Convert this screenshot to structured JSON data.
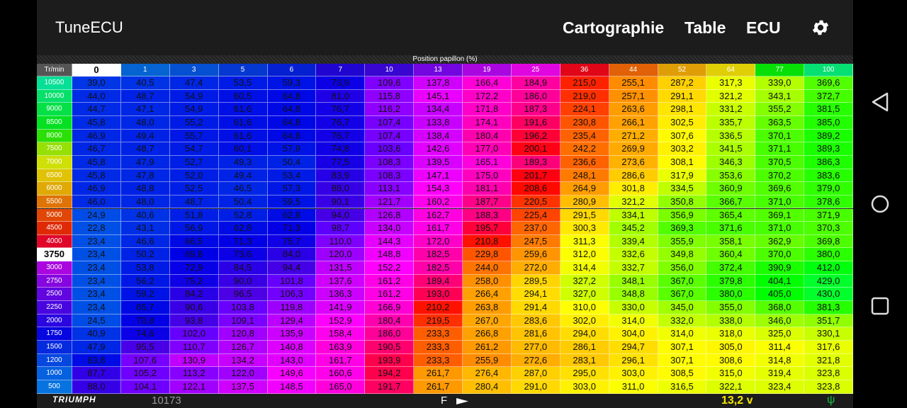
{
  "app": {
    "title": "TuneECU",
    "menu": [
      "Cartographie",
      "Table",
      "ECU"
    ]
  },
  "icons": {
    "settings": "gear-icon",
    "back": "triangle-back-icon",
    "home": "circle-home-icon",
    "recents": "square-recents-icon",
    "usb": "usb-icon",
    "arrow": "play-arrow-icon"
  },
  "table": {
    "caption": "Position papillon (%)",
    "corner": "Tr/min",
    "columns": [
      "0",
      "1",
      "3",
      "5",
      "6",
      "7",
      "10",
      "13",
      "19",
      "25",
      "36",
      "44",
      "52",
      "64",
      "77",
      "100"
    ],
    "selected_col": 0,
    "selected_row": 13,
    "rows": [
      {
        "rpm": "10500",
        "values": [
          "39,0",
          "40,5",
          "47,4",
          "53,5",
          "59,3",
          "73,9",
          "109,6",
          "137,8",
          "166,4",
          "184,9",
          "215,0",
          "255,1",
          "287,2",
          "317,3",
          "339,0",
          "369,6"
        ]
      },
      {
        "rpm": "10000",
        "values": [
          "44,0",
          "48,7",
          "54,9",
          "60,5",
          "64,8",
          "81,0",
          "115,8",
          "145,1",
          "172,2",
          "186,0",
          "219,0",
          "257,1",
          "291,1",
          "321,2",
          "343,1",
          "372,7"
        ]
      },
      {
        "rpm": "9000",
        "values": [
          "44,7",
          "47,1",
          "54,9",
          "61,6",
          "64,8",
          "76,7",
          "116,2",
          "134,4",
          "171,8",
          "187,3",
          "224,1",
          "263,6",
          "298,1",
          "331,2",
          "355,2",
          "381,5"
        ]
      },
      {
        "rpm": "8500",
        "values": [
          "45,8",
          "48,0",
          "55,2",
          "61,6",
          "64,8",
          "76,7",
          "107,4",
          "133,8",
          "174,1",
          "191,6",
          "230,8",
          "266,1",
          "302,5",
          "335,7",
          "363,5",
          "385,0"
        ]
      },
      {
        "rpm": "8000",
        "values": [
          "46,9",
          "49,4",
          "55,7",
          "61,6",
          "64,8",
          "76,7",
          "107,4",
          "138,4",
          "180,4",
          "196,2",
          "235,4",
          "271,2",
          "307,6",
          "336,5",
          "370,1",
          "389,2"
        ]
      },
      {
        "rpm": "7500",
        "values": [
          "46,7",
          "48,7",
          "54,7",
          "60,1",
          "57,9",
          "74,8",
          "103,6",
          "142,6",
          "177,0",
          "200,1",
          "242,2",
          "269,9",
          "303,2",
          "341,5",
          "371,1",
          "389,3"
        ]
      },
      {
        "rpm": "7000",
        "values": [
          "45,8",
          "47,9",
          "52,7",
          "49,3",
          "50,4",
          "77,5",
          "108,3",
          "139,5",
          "165,1",
          "189,3",
          "236,6",
          "273,6",
          "308,1",
          "346,3",
          "370,5",
          "386,3"
        ]
      },
      {
        "rpm": "6500",
        "values": [
          "45,8",
          "47,8",
          "52,0",
          "49,4",
          "53,4",
          "83,9",
          "108,3",
          "147,1",
          "175,0",
          "201,7",
          "248,1",
          "286,6",
          "317,9",
          "353,6",
          "370,2",
          "383,6"
        ]
      },
      {
        "rpm": "6000",
        "values": [
          "46,9",
          "48,8",
          "52,5",
          "46,5",
          "57,3",
          "88,0",
          "113,1",
          "154,3",
          "181,1",
          "208,6",
          "264,9",
          "301,8",
          "334,5",
          "360,9",
          "369,6",
          "379,0"
        ]
      },
      {
        "rpm": "5500",
        "values": [
          "46,0",
          "48,0",
          "48,7",
          "50,4",
          "59,5",
          "90,1",
          "121,7",
          "160,2",
          "187,7",
          "220,5",
          "280,9",
          "321,2",
          "350,8",
          "366,7",
          "371,0",
          "378,6"
        ]
      },
      {
        "rpm": "5000",
        "values": [
          "24,9",
          "40,6",
          "51,8",
          "52,8",
          "62,8",
          "94,0",
          "126,8",
          "162,7",
          "188,3",
          "225,4",
          "291,5",
          "334,1",
          "356,9",
          "365,4",
          "369,1",
          "371,9"
        ]
      },
      {
        "rpm": "4500",
        "values": [
          "22,8",
          "43,1",
          "56,9",
          "62,8",
          "71,3",
          "98,7",
          "134,0",
          "161,7",
          "195,7",
          "237,0",
          "300,3",
          "345,2",
          "369,3",
          "371,6",
          "371,0",
          "370,3"
        ]
      },
      {
        "rpm": "4000",
        "values": [
          "23,4",
          "46,6",
          "66,5",
          "71,3",
          "75,7",
          "110,0",
          "144,3",
          "172,0",
          "210,8",
          "247,5",
          "311,3",
          "339,4",
          "355,9",
          "358,1",
          "362,9",
          "369,8"
        ]
      },
      {
        "rpm": "3750",
        "values": [
          "23,4",
          "50,2",
          "69,8",
          "73,6",
          "84,0",
          "120,0",
          "148,8",
          "182,5",
          "229,8",
          "259,6",
          "312,0",
          "332,6",
          "349,8",
          "360,4",
          "370,0",
          "380,0"
        ]
      },
      {
        "rpm": "3000",
        "values": [
          "23,4",
          "53,8",
          "72,9",
          "84,5",
          "94,4",
          "131,5",
          "152,2",
          "182,5",
          "244,0",
          "272,0",
          "314,4",
          "332,7",
          "356,0",
          "372,4",
          "390,9",
          "412,0"
        ]
      },
      {
        "rpm": "2750",
        "values": [
          "23,4",
          "56,2",
          "75,2",
          "90,0",
          "101,8",
          "137,6",
          "161,2",
          "189,4",
          "258,0",
          "289,5",
          "327,2",
          "348,1",
          "367,0",
          "379,8",
          "404,1",
          "429,0"
        ]
      },
      {
        "rpm": "2500",
        "values": [
          "23,4",
          "59,2",
          "84,2",
          "96,5",
          "106,3",
          "136,3",
          "161,2",
          "193,0",
          "266,4",
          "294,1",
          "327,0",
          "348,8",
          "367,0",
          "380,0",
          "405,0",
          "430,0"
        ]
      },
      {
        "rpm": "2250",
        "values": [
          "23,4",
          "65,7",
          "90,6",
          "103,8",
          "119,8",
          "141,9",
          "166,9",
          "210,2",
          "263,8",
          "291,4",
          "310,0",
          "330,0",
          "345,0",
          "355,0",
          "368,0",
          "381,3"
        ]
      },
      {
        "rpm": "2000",
        "values": [
          "24,5",
          "70,8",
          "93,8",
          "109,1",
          "129,4",
          "152,9",
          "180,4",
          "219,5",
          "267,0",
          "283,6",
          "302,0",
          "314,0",
          "332,0",
          "338,0",
          "346,0",
          "351,7"
        ]
      },
      {
        "rpm": "1750",
        "values": [
          "40,9",
          "74,6",
          "102,0",
          "120,8",
          "135,9",
          "158,4",
          "186,0",
          "233,3",
          "266,8",
          "281,6",
          "294,0",
          "304,0",
          "314,0",
          "318,0",
          "325,0",
          "330,1"
        ]
      },
      {
        "rpm": "1500",
        "values": [
          "47,9",
          "95,5",
          "110,7",
          "126,7",
          "140,8",
          "163,9",
          "190,5",
          "233,3",
          "261,2",
          "277,0",
          "286,1",
          "294,7",
          "307,1",
          "305,0",
          "311,4",
          "317,6"
        ]
      },
      {
        "rpm": "1200",
        "values": [
          "63,8",
          "107,6",
          "130,9",
          "134,2",
          "143,0",
          "161,7",
          "193,9",
          "233,3",
          "255,9",
          "272,6",
          "283,1",
          "296,1",
          "307,1",
          "308,6",
          "314,8",
          "321,8"
        ]
      },
      {
        "rpm": "1000",
        "values": [
          "87,7",
          "105,2",
          "113,2",
          "122,0",
          "149,6",
          "160,6",
          "194,2",
          "261,7",
          "276,4",
          "287,0",
          "295,0",
          "303,0",
          "308,5",
          "315,0",
          "319,4",
          "323,8"
        ]
      },
      {
        "rpm": "500",
        "values": [
          "88,0",
          "104,1",
          "122,1",
          "137,5",
          "148,5",
          "165,0",
          "191,7",
          "261,7",
          "280,4",
          "291,0",
          "303,0",
          "311,0",
          "316,5",
          "322,1",
          "323,4",
          "323,8"
        ]
      }
    ]
  },
  "footer": {
    "brand": "TRIUMPH",
    "rpm": "10173",
    "direction": "F",
    "voltage": "13,2 v"
  },
  "colors": {
    "background": "#1c1c1c",
    "voltage": "#f5e600",
    "usb": "#18c040",
    "selected": "#ffffff"
  }
}
